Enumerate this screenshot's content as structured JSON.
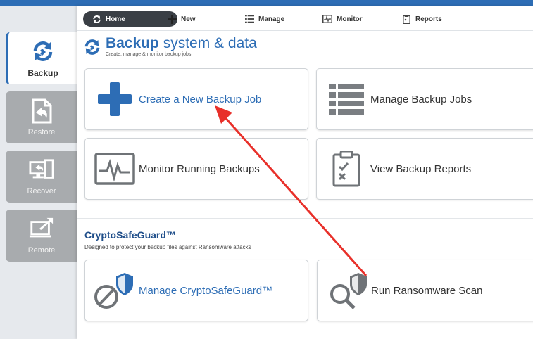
{
  "sidebar": {
    "items": [
      {
        "label": "Backup"
      },
      {
        "label": "Restore"
      },
      {
        "label": "Recover"
      },
      {
        "label": "Remote"
      }
    ]
  },
  "nav": {
    "items": [
      {
        "label": "Home"
      },
      {
        "label": "New"
      },
      {
        "label": "Manage"
      },
      {
        "label": "Monitor"
      },
      {
        "label": "Reports"
      }
    ]
  },
  "header": {
    "title_bold": "Backup",
    "title_rest": "system & data",
    "subtitle": "Create, manage & monitor backup jobs"
  },
  "cards": [
    {
      "label": "Create a New Backup Job",
      "icon": "plus-icon"
    },
    {
      "label": "Manage Backup Jobs",
      "icon": "list-icon"
    },
    {
      "label": "Monitor Running Backups",
      "icon": "monitor-pulse-icon"
    },
    {
      "label": "View Backup Reports",
      "icon": "clipboard-check-icon"
    }
  ],
  "cryptosafeguard": {
    "title": "CryptoSafeGuard™",
    "subtitle": "Designed to protect your backup files against Ransomware attacks",
    "cards": [
      {
        "label": "Manage CryptoSafeGuard™",
        "icon": "shield-block-icon"
      },
      {
        "label": "Run Ransomware Scan",
        "icon": "shield-search-icon"
      }
    ]
  },
  "colors": {
    "accent": "#2d6db5",
    "annotation_arrow": "#e8302a"
  }
}
